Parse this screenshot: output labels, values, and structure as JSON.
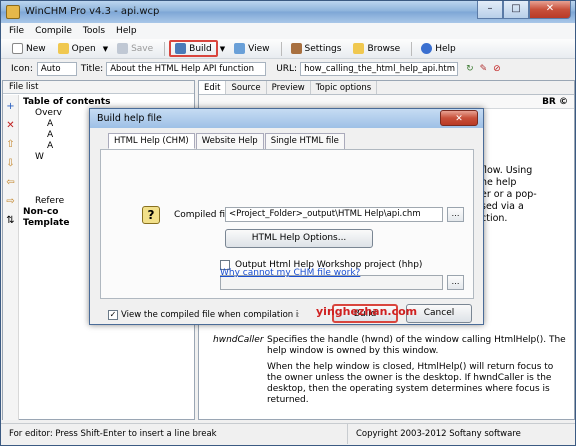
{
  "window": {
    "title": "WinCHM Pro v4.3 - api.wcp",
    "close_glyph": "✕",
    "min_glyph": "–",
    "max_glyph": "□"
  },
  "menu": [
    "File",
    "Compile",
    "Tools",
    "Help"
  ],
  "toolbar": {
    "new": "New",
    "open": "Open",
    "save": "Save",
    "build": "Build",
    "view": "View",
    "settings": "Settings",
    "browse": "Browse",
    "help": "Help"
  },
  "props": {
    "icon_label": "Icon:",
    "icon_value": "Auto",
    "title_label": "Title:",
    "title_value": "About the HTML Help API function",
    "url_label": "URL:",
    "url_value": "how_calling_the_html_help_api.htm"
  },
  "left_panel": {
    "header": "File list",
    "tree": [
      "Table of contents",
      "Overv",
      "A",
      "A",
      "A",
      "W",
      "Refere",
      "Non-co",
      "Template"
    ]
  },
  "editor": {
    "tabs": [
      "Edit",
      "Source",
      "Preview",
      "Topic options"
    ],
    "text_lines": [
      "flow. Using",
      "he help",
      "er or a pop-",
      "sed via a",
      "ction."
    ],
    "param_name": "hwndCaller",
    "param_desc": "Specifies the handle (hwnd) of the window calling HtmlHelp(). The help window is owned by this window.",
    "param_desc2": "When the help window is closed, HtmlHelp() will return focus to the owner unless the owner is the desktop. If hwndCaller is the desktop, then the operating system determines where focus is returned."
  },
  "dialog": {
    "title": "Build help file",
    "tabs": [
      "HTML Help (CHM)",
      "Website Help",
      "Single HTML file"
    ],
    "compiled_label": "Compiled file:",
    "compiled_value": "<Project_Folder>_output\\HTML Help\\api.chm",
    "options_button": "HTML Help Options...",
    "hhp_label": "Output Html Help Workshop project (hhp)",
    "why_link": "Why cannot my CHM file work?",
    "view_check": "View the compiled file when compilation is finished",
    "build_button": "Build",
    "cancel_button": "Cancel"
  },
  "watermark": "yinghezhan.com",
  "status": {
    "left": "For editor: Press Shift-Enter to insert a line break",
    "right": "Copyright 2003-2012 Softany software"
  }
}
